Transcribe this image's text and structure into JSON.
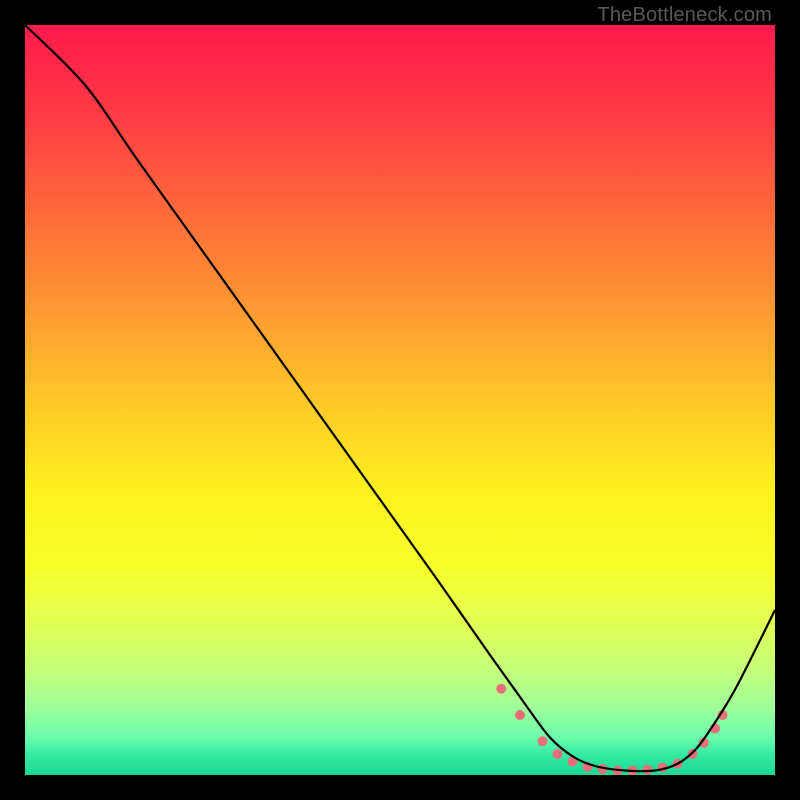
{
  "watermark": "TheBottleneck.com",
  "chart_data": {
    "type": "line",
    "title": "",
    "xlabel": "",
    "ylabel": "",
    "xlim": [
      0,
      100
    ],
    "ylim": [
      0,
      100
    ],
    "background_gradient": {
      "stops": [
        {
          "offset": 0.0,
          "color": "#ff1a4c"
        },
        {
          "offset": 0.12,
          "color": "#ff3b44"
        },
        {
          "offset": 0.25,
          "color": "#ff6a3a"
        },
        {
          "offset": 0.38,
          "color": "#ff9932"
        },
        {
          "offset": 0.5,
          "color": "#ffc728"
        },
        {
          "offset": 0.62,
          "color": "#fff020"
        },
        {
          "offset": 0.72,
          "color": "#f7ff2a"
        },
        {
          "offset": 0.8,
          "color": "#e0ff55"
        },
        {
          "offset": 0.86,
          "color": "#c4ff7a"
        },
        {
          "offset": 0.91,
          "color": "#9fff9a"
        },
        {
          "offset": 0.95,
          "color": "#6affad"
        },
        {
          "offset": 0.975,
          "color": "#30e8a0"
        },
        {
          "offset": 1.0,
          "color": "#1ed795"
        }
      ]
    },
    "series": [
      {
        "name": "bottleneck-curve",
        "color": "#000000",
        "x": [
          0.0,
          8.0,
          15.0,
          25.0,
          35.0,
          45.0,
          55.0,
          62.0,
          67.0,
          70.0,
          73.0,
          76.0,
          80.0,
          84.0,
          87.0,
          89.5,
          92.0,
          95.0,
          100.0
        ],
        "y": [
          100.0,
          92.0,
          82.0,
          68.0,
          54.0,
          40.0,
          26.0,
          16.0,
          9.0,
          5.0,
          2.5,
          1.2,
          0.6,
          0.6,
          1.5,
          3.5,
          7.0,
          12.0,
          22.0
        ]
      }
    ],
    "markers": {
      "name": "tolerance-band-points",
      "color": "#e76f7a",
      "radius": 5,
      "x": [
        63.5,
        66.0,
        69.0,
        71.0,
        73.0,
        75.0,
        77.0,
        79.0,
        81.0,
        83.0,
        85.0,
        87.0,
        89.0,
        90.5,
        92.0,
        93.0
      ],
      "y": [
        11.5,
        8.0,
        4.5,
        2.8,
        1.8,
        1.1,
        0.8,
        0.6,
        0.6,
        0.7,
        1.0,
        1.5,
        2.8,
        4.3,
        6.2,
        8.0
      ]
    }
  }
}
